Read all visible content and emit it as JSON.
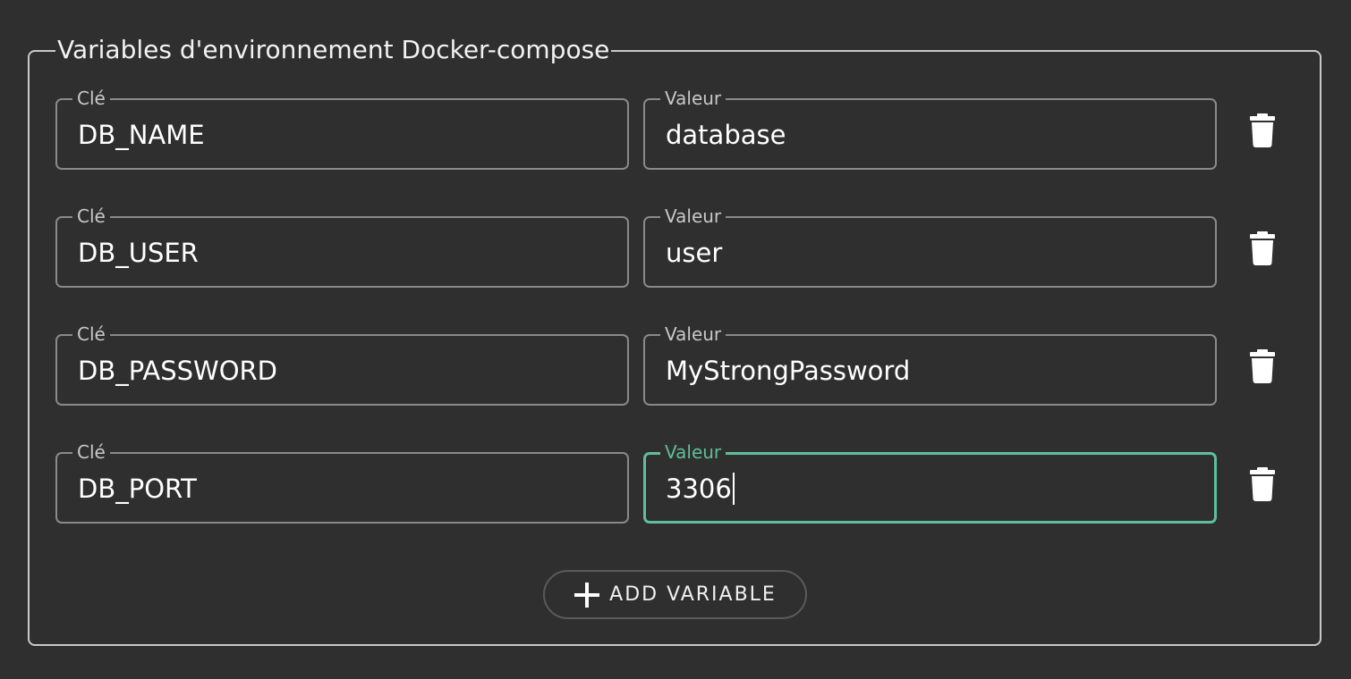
{
  "section": {
    "title": "Variables d'environnement Docker-compose"
  },
  "labels": {
    "key": "Clé",
    "value": "Valeur"
  },
  "variables": [
    {
      "key": "DB_NAME",
      "value": "database"
    },
    {
      "key": "DB_USER",
      "value": "user"
    },
    {
      "key": "DB_PASSWORD",
      "value": "MyStrongPassword"
    },
    {
      "key": "DB_PORT",
      "value": "3306",
      "focused": true
    }
  ],
  "add_button": {
    "label": "ADD VARIABLE",
    "icon": "plus-icon"
  },
  "row_action_icon": "trash-icon",
  "colors": {
    "background": "#2f2f2f",
    "accent": "#5fbf9a",
    "border": "#8a8a8a",
    "text": "#ffffff"
  }
}
